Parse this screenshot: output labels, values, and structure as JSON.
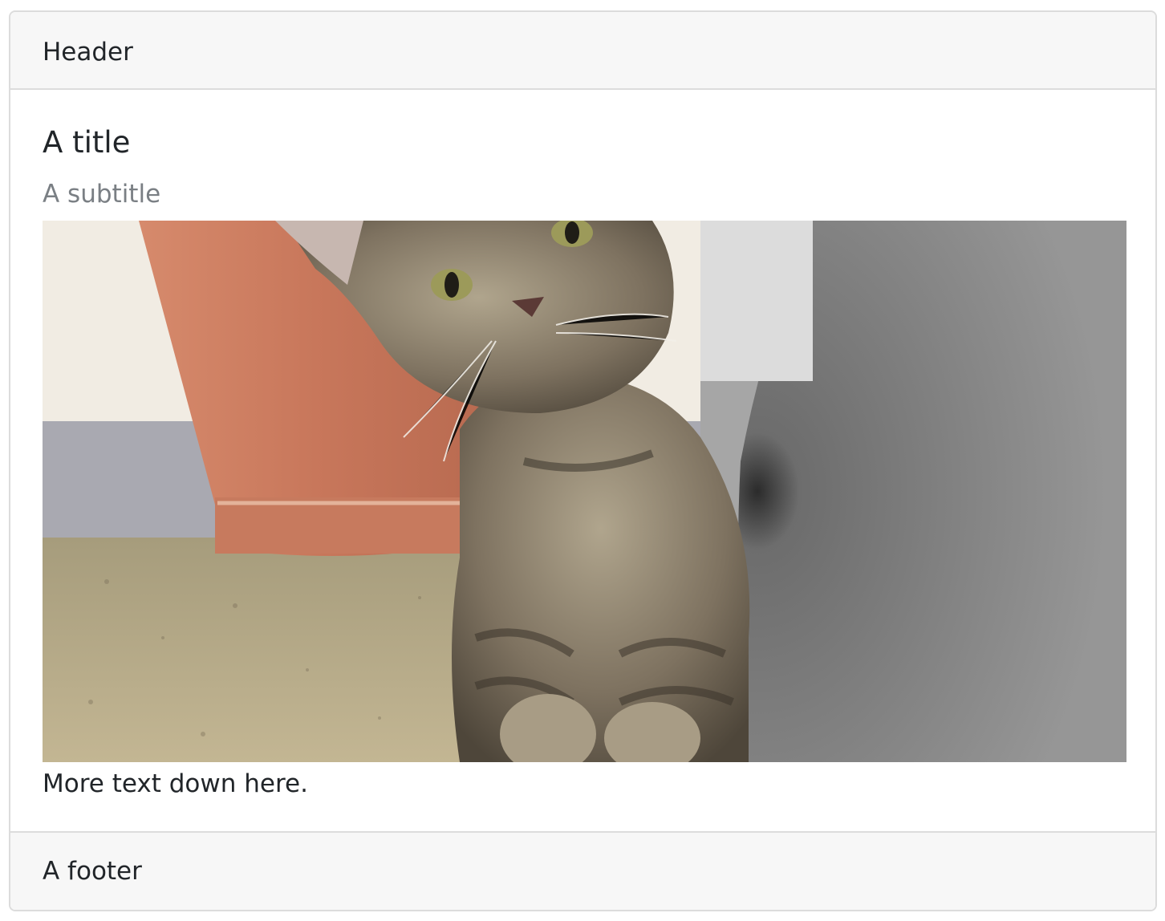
{
  "card": {
    "header": "Header",
    "title": "A title",
    "subtitle": "A subtitle",
    "image": {
      "icon": "kitten-photo",
      "colors": {
        "wall_top": "#f1ece3",
        "wall_band": "#a9a9b1",
        "pot": "#c97a5f",
        "ground": "#b5a985",
        "concrete": "#8f8f8f",
        "fur": "#8b7d66"
      }
    },
    "text": "More text down here.",
    "footer": "A footer"
  }
}
